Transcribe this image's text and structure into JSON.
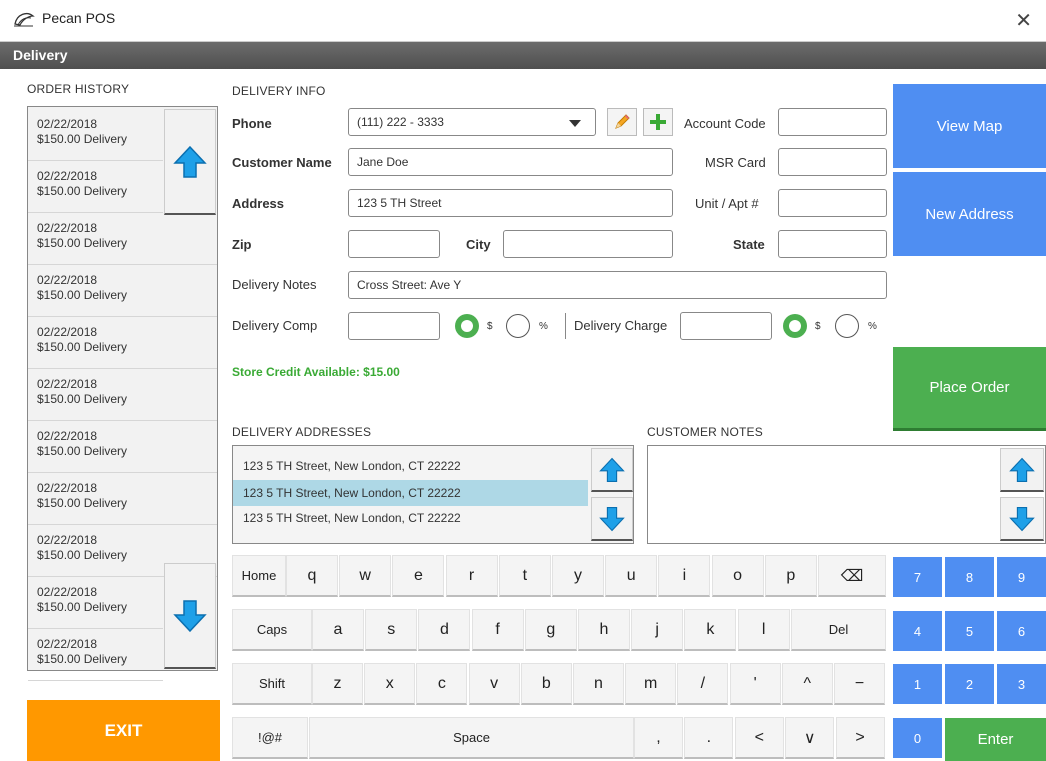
{
  "window": {
    "title": "Pecan POS",
    "close": "✕"
  },
  "subheader": {
    "title": "Delivery"
  },
  "order_history": {
    "heading": "ORDER HISTORY",
    "items": [
      {
        "date": "02/22/2018",
        "desc": "$150.00 Delivery"
      },
      {
        "date": "02/22/2018",
        "desc": "$150.00 Delivery"
      },
      {
        "date": "02/22/2018",
        "desc": "$150.00 Delivery"
      },
      {
        "date": "02/22/2018",
        "desc": "$150.00 Delivery"
      },
      {
        "date": "02/22/2018",
        "desc": "$150.00 Delivery"
      },
      {
        "date": "02/22/2018",
        "desc": "$150.00 Delivery"
      },
      {
        "date": "02/22/2018",
        "desc": "$150.00 Delivery"
      },
      {
        "date": "02/22/2018",
        "desc": "$150.00 Delivery"
      },
      {
        "date": "02/22/2018",
        "desc": "$150.00 Delivery"
      },
      {
        "date": "02/22/2018",
        "desc": "$150.00 Delivery"
      },
      {
        "date": "02/22/2018",
        "desc": "$150.00 Delivery"
      }
    ]
  },
  "exit_label": "EXIT",
  "delivery_info": {
    "heading": "DELIVERY INFO",
    "phone_label": "Phone",
    "phone_value": "(111) 222 - 3333",
    "customer_name_label": "Customer Name",
    "customer_name_value": "Jane Doe",
    "address_label": "Address",
    "address_value": "123 5 TH Street",
    "zip_label": "Zip",
    "zip_value": "",
    "city_label": "City",
    "city_value": "",
    "state_label": "State",
    "state_value": "",
    "notes_label": "Delivery Notes",
    "notes_value": "Cross Street: Ave Y",
    "comp_label": "Delivery Comp",
    "comp_value": "",
    "charge_label": "Delivery Charge",
    "charge_value": "",
    "dollar": "$",
    "percent": "%",
    "account_code_label": "Account Code",
    "account_code_value": "",
    "msr_label": "MSR Card",
    "msr_value": "",
    "unit_label": "Unit / Apt #",
    "unit_value": "",
    "store_credit": "Store Credit Available: $15.00"
  },
  "buttons": {
    "view_map": "View Map",
    "new_address": "New Address",
    "place_order": "Place Order"
  },
  "delivery_addresses": {
    "heading": "DELIVERY ADDRESSES",
    "items": [
      "123 5 TH Street, New London, CT 22222",
      "123 5 TH Street, New London, CT 22222",
      "123 5 TH Street, New London, CT 22222"
    ],
    "selected_index": 1
  },
  "customer_notes": {
    "heading": "CUSTOMER NOTES",
    "value": ""
  },
  "keyboard": {
    "row1": [
      "Home",
      "q",
      "w",
      "e",
      "r",
      "t",
      "y",
      "u",
      "i",
      "o",
      "p",
      "⌫"
    ],
    "row2": [
      "Caps",
      "a",
      "s",
      "d",
      "f",
      "g",
      "h",
      "j",
      "k",
      "l",
      "Del"
    ],
    "row3": [
      "Shift",
      "z",
      "x",
      "c",
      "v",
      "b",
      "n",
      "m",
      "/",
      "'",
      "^",
      "−"
    ],
    "row4": [
      "!@#",
      "Space",
      ",",
      ".",
      "<",
      "∨",
      ">"
    ],
    "numpad": [
      "7",
      "8",
      "9",
      "4",
      "5",
      "6",
      "1",
      "2",
      "3",
      "0"
    ],
    "enter": "Enter"
  },
  "colors": {
    "blue": "#4f8ef2",
    "green": "#4caf50",
    "exit": "#ff9800",
    "selected_row": "#aed8e6",
    "credit_text": "#3aaa35"
  }
}
